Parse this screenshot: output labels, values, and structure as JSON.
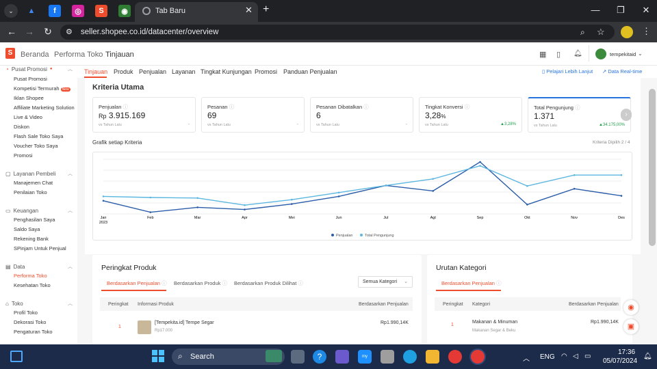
{
  "browser": {
    "tab_title": "Tab Baru",
    "url": "seller.shopee.co.id/datacenter/overview"
  },
  "header": {
    "breadcrumb": [
      "Beranda",
      "Performa Toko",
      "Tinjauan"
    ],
    "shop_name": "tempekitaid"
  },
  "sidebar": {
    "groups": [
      {
        "title": "Pusat Promosi",
        "items": [
          "Pusat Promosi",
          "Kompetisi Termurah",
          "Iklan Shopee",
          "Affiliate Marketing Solution",
          "Live & Video",
          "Diskon",
          "Flash Sale Toko Saya",
          "Voucher Toko Saya",
          "Promosi"
        ]
      },
      {
        "title": "Layanan Pembeli",
        "items": [
          "Manajemen Chat",
          "Penilaian Toko"
        ]
      },
      {
        "title": "Keuangan",
        "items": [
          "Penghasilan Saya",
          "Saldo Saya",
          "Rekening Bank",
          "SPinjam Untuk Penjual"
        ]
      },
      {
        "title": "Data",
        "items": [
          "Performa Toko",
          "Kesehatan Toko"
        ]
      },
      {
        "title": "Toko",
        "items": [
          "Profil Toko",
          "Dekorasi Toko",
          "Pengaturan Toko"
        ]
      }
    ],
    "new_badge": "New"
  },
  "nav_tabs": [
    "Tinjauan",
    "Produk",
    "Penjualan",
    "Layanan",
    "Tingkat Kunjungan",
    "Promosi",
    "Panduan Penjualan"
  ],
  "links": {
    "learn_more": "Pelajari Lebih Lanjut",
    "realtime": "Data Real-time"
  },
  "kriteria": {
    "title": "Kriteria Utama",
    "cards": [
      {
        "label": "Penjualan",
        "prefix": "Rp",
        "value": "3.915.169",
        "sub": "vs Tahun Lalu",
        "change": "-"
      },
      {
        "label": "Pesanan",
        "prefix": "",
        "value": "69",
        "sub": "vs Tahun Lalu",
        "change": "-"
      },
      {
        "label": "Pesanan Dibatalkan",
        "prefix": "",
        "value": "6",
        "sub": "vs Tahun Lalu",
        "change": "-"
      },
      {
        "label": "Tingkat Konversi",
        "prefix": "",
        "value": "3,28",
        "suffix": "%",
        "sub": "vs Tahun Lalu",
        "change": "▲3,28%"
      },
      {
        "label": "Total Pengunjung",
        "prefix": "",
        "value": "1.371",
        "sub": "vs Tahun Lalu",
        "change": "▲34.175,00%"
      }
    ]
  },
  "chart": {
    "title": "Grafik setiap Kriteria",
    "selected": "Kriteria Dipilih 2 / 4",
    "year": "2023",
    "colors": {
      "penjualan": "#2a5ca8",
      "pengunjung": "#5bb6e0"
    }
  },
  "chart_data": {
    "type": "line",
    "categories": [
      "Jan",
      "Feb",
      "Mar",
      "Apr",
      "Mei",
      "Jun",
      "Jul",
      "Agt",
      "Sep",
      "Okt",
      "Nov",
      "Des"
    ],
    "series": [
      {
        "name": "Penjualan",
        "values": [
          24,
          3,
          12,
          8,
          18,
          32,
          52,
          42,
          95,
          17,
          46,
          33
        ]
      },
      {
        "name": "Total Pengunjung",
        "values": [
          32,
          30,
          29,
          16,
          26,
          39,
          52,
          64,
          88,
          51,
          71,
          71
        ]
      }
    ],
    "ylim": [
      0,
      100
    ],
    "legend": "bottom-center",
    "grid": true
  },
  "peringkat": {
    "title": "Peringkat Produk",
    "tabs": [
      "Berdasarkan Penjualan",
      "Berdasarkan Produk",
      "Berdasarkan Produk Dilihat"
    ],
    "category_select": "Semua Kategori",
    "columns": [
      "Peringkat",
      "Informasi Produk",
      "Berdasarkan Penjualan"
    ],
    "rows": [
      {
        "rank": "1",
        "name": "[Tempekita.id] Tempe Segar",
        "price": "Rp17.000",
        "sales": "Rp1.990,14K"
      }
    ]
  },
  "urutan": {
    "title": "Urutan Kategori",
    "tabs": [
      "Berdasarkan Penjualan"
    ],
    "columns": [
      "Peringkat",
      "Kategori",
      "Berdasarkan Penjualan"
    ],
    "rows": [
      {
        "rank": "1",
        "category": "Makanan & Minuman",
        "sub": "Makanan Segar & Beku",
        "sales": "Rp1.990,14K"
      }
    ]
  },
  "taskbar": {
    "search": "Search",
    "lang": "ENG",
    "time": "17:36",
    "date": "05/07/2024"
  }
}
